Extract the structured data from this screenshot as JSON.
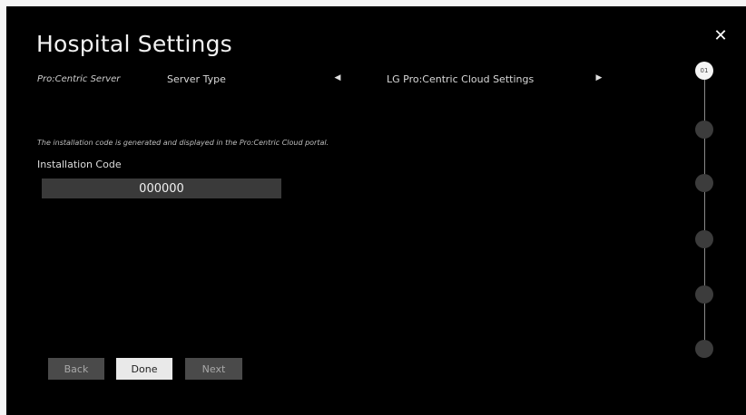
{
  "header": {
    "title": "Hospital Settings",
    "close_icon": "close-icon"
  },
  "server": {
    "section_label": "Pro:Centric Server",
    "type_label": "Server Type",
    "type_value": "LG Pro:Centric Cloud Settings",
    "prev_icon": "triangle-left-icon",
    "next_icon": "triangle-right-icon"
  },
  "installation": {
    "hint": "The installation code is generated and displayed in the Pro:Centric Cloud portal.",
    "label": "Installation Code",
    "value": "000000"
  },
  "buttons": {
    "back": "Back",
    "done": "Done",
    "next": "Next"
  },
  "stepper": {
    "active_step": "01",
    "total_steps": 6
  },
  "colors": {
    "background": "#000000",
    "input_bg": "#3a3a3a",
    "active_button": "#e9e9e9",
    "inactive_button": "#4a4a4a"
  }
}
